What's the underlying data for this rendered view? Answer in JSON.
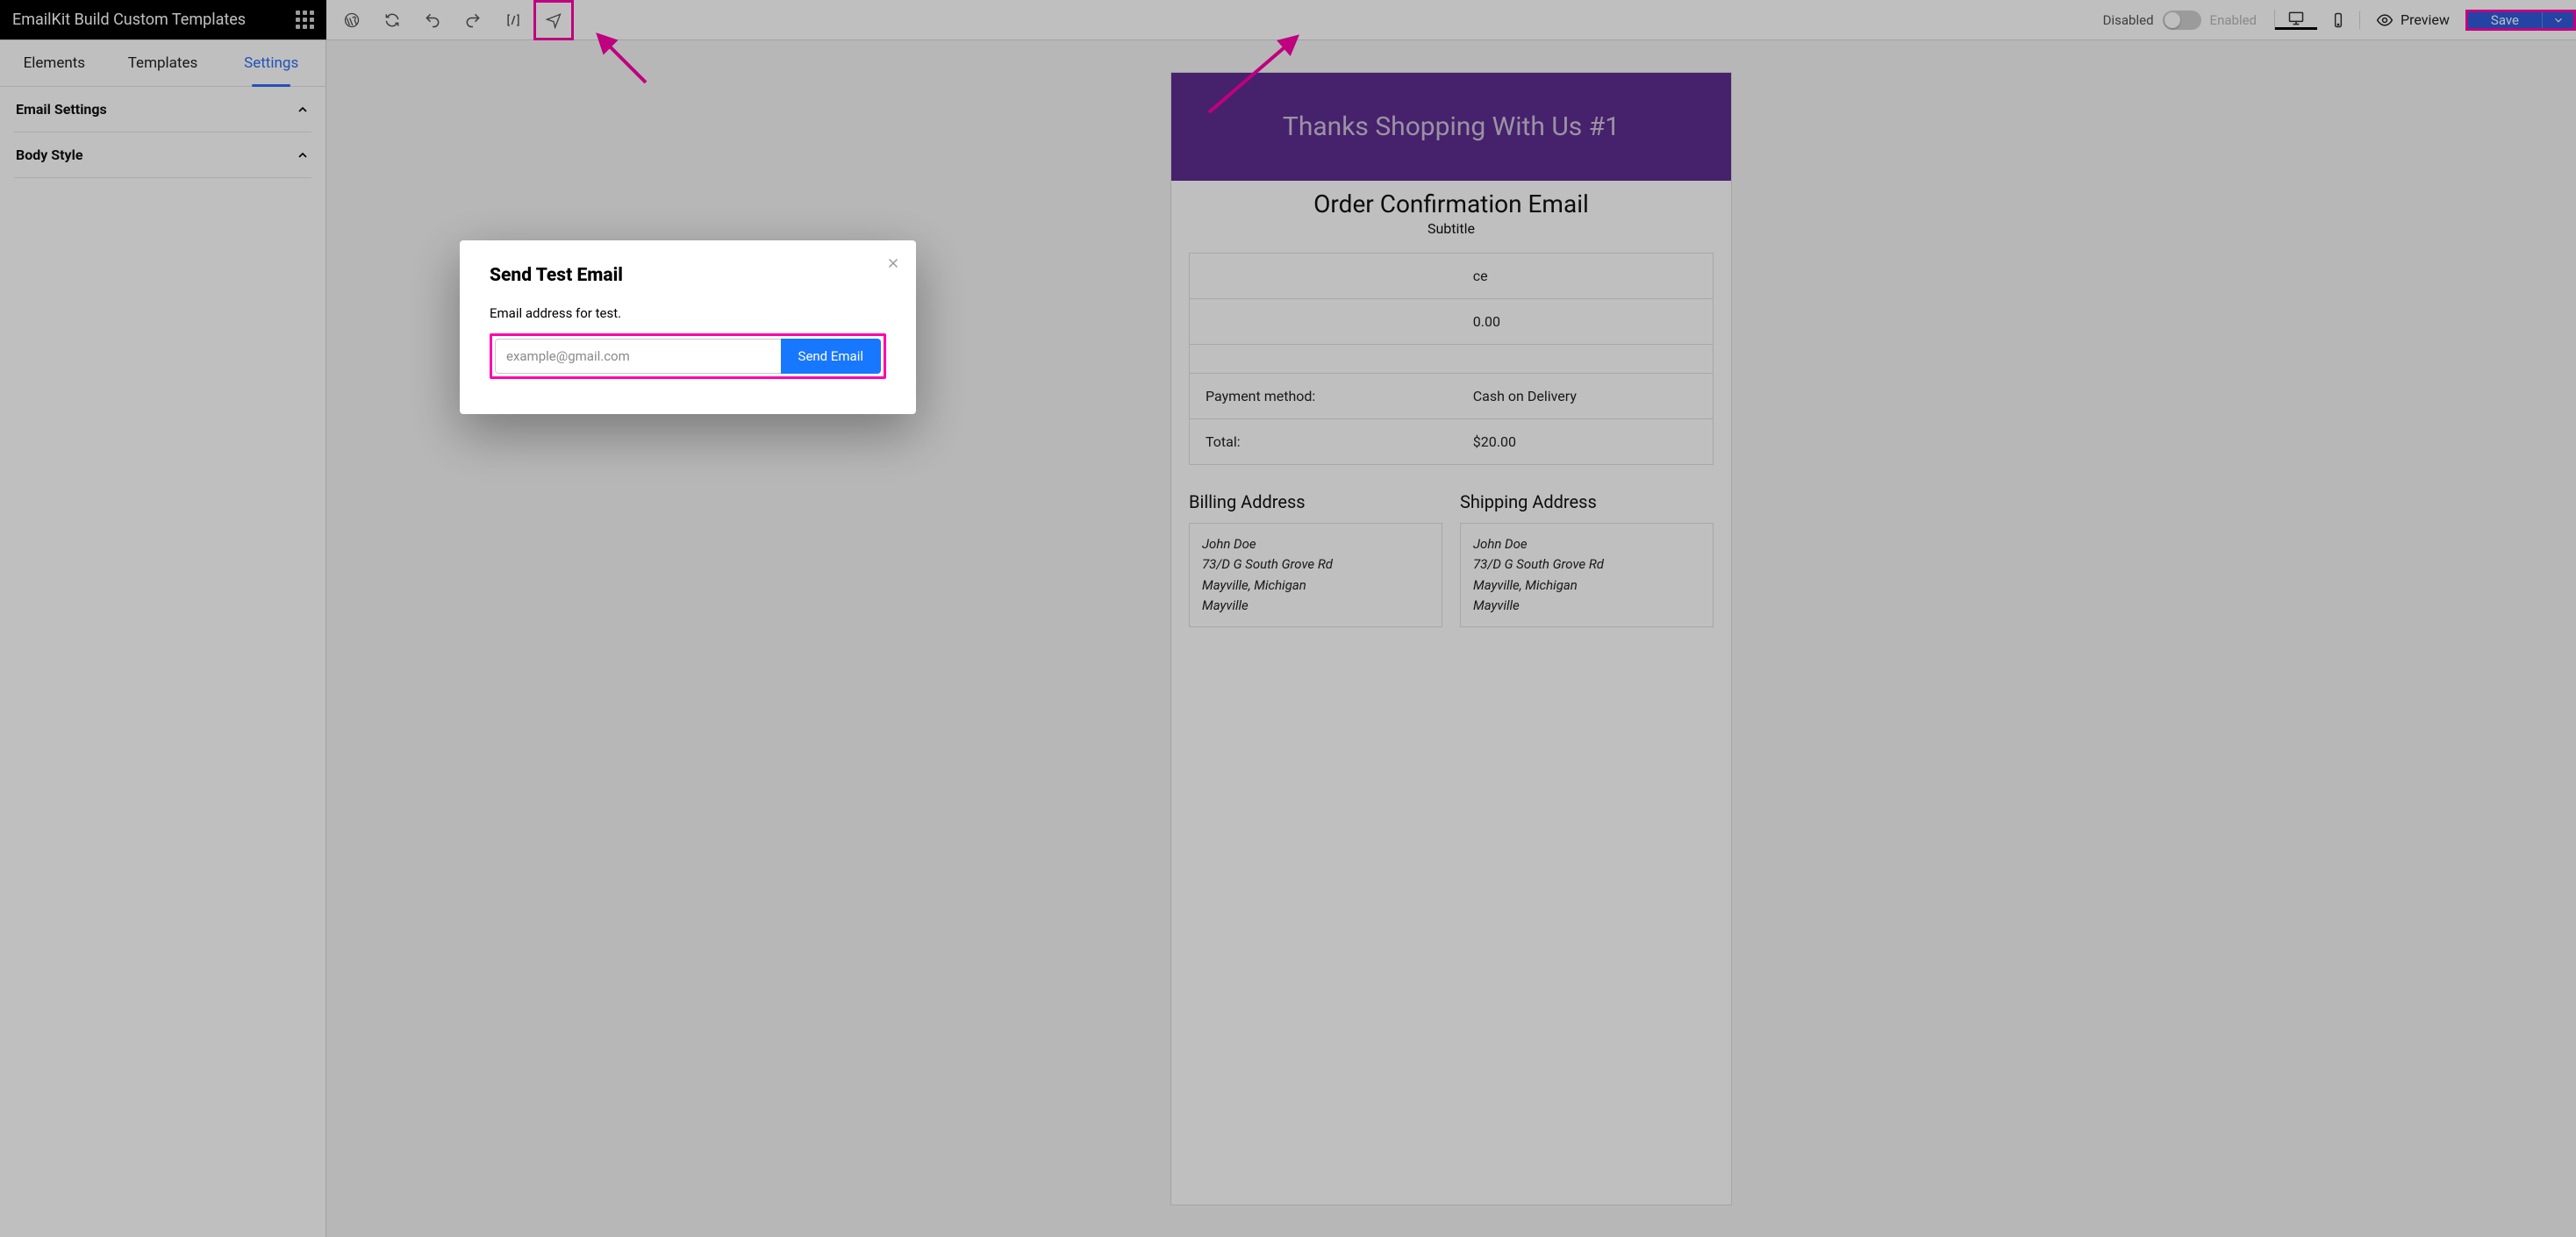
{
  "brand": {
    "title": "EmailKit Build Custom Templates"
  },
  "toolbar": {
    "toggle": {
      "left": "Disabled",
      "right": "Enabled",
      "state": "off"
    },
    "preview_label": "Preview",
    "save_label": "Save"
  },
  "sidebar": {
    "tabs": [
      {
        "label": "Elements",
        "active": false
      },
      {
        "label": "Templates",
        "active": false
      },
      {
        "label": "Settings",
        "active": true
      }
    ],
    "accordion": [
      {
        "label": "Email Settings"
      },
      {
        "label": "Body Style"
      }
    ]
  },
  "email": {
    "hero": "Thanks Shopping With Us #1",
    "title": "Order Confirmation Email",
    "subtitle": "Subtitle",
    "rows": [
      {
        "label": "",
        "value": "ce"
      },
      {
        "label": "",
        "value": "0.00"
      },
      {
        "label": "",
        "value": ""
      },
      {
        "label": "Payment method:",
        "value": "Cash on Delivery"
      },
      {
        "label": "Total:",
        "value": "$20.00"
      }
    ],
    "billing": {
      "heading": "Billing Address",
      "lines": [
        "John Doe",
        "73/D G South Grove Rd",
        "Mayville, Michigan",
        "Mayville"
      ]
    },
    "shipping": {
      "heading": "Shipping Address",
      "lines": [
        "John Doe",
        "73/D G South Grove Rd",
        "Mayville, Michigan",
        "Mayville"
      ]
    }
  },
  "modal": {
    "title": "Send Test Email",
    "label": "Email address for test.",
    "placeholder": "example@gmail.com",
    "value": "",
    "send_label": "Send Email"
  }
}
